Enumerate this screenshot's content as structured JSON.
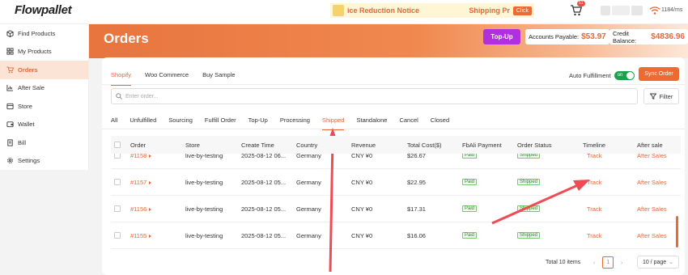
{
  "topbar": {
    "logo": "Flowpallet",
    "notice_left": "ice Reduction Notice",
    "notice_right": "Shipping Pr",
    "notice_button": "Click",
    "cart_badge": "51",
    "ping": "1184/ms"
  },
  "sidebar": {
    "items": [
      {
        "label": "Find Products",
        "icon": "box-icon"
      },
      {
        "label": "My Products",
        "icon": "grid-icon"
      },
      {
        "label": "Orders",
        "icon": "cart-icon",
        "active": true
      },
      {
        "label": "After Sale",
        "icon": "chart-icon"
      },
      {
        "label": "Store",
        "icon": "store-icon"
      },
      {
        "label": "Wallet",
        "icon": "wallet-icon"
      },
      {
        "label": "Bill",
        "icon": "bill-icon"
      },
      {
        "label": "Settings",
        "icon": "gear-icon"
      }
    ]
  },
  "header": {
    "title": "Orders",
    "topup": "Top-Up",
    "accounts_payable_label": "Accounts Payable:",
    "accounts_payable_value": "$53.97",
    "credit_balance_label": "Credit Balance:",
    "credit_balance_value": "$4836.96"
  },
  "platform_tabs": [
    "Shopify",
    "Woo Commerce",
    "Buy Sample"
  ],
  "auto_fulfillment": {
    "label": "Auto Fulfillment",
    "toggle": "on"
  },
  "sync_order": "Sync Order",
  "search": {
    "placeholder": "Enter order..."
  },
  "filter": "Filter",
  "status_tabs": [
    "All",
    "Unfulfilled",
    "Sourcing",
    "Fulfill Order",
    "Top-Up",
    "Processing",
    "Shipped",
    "Standalone",
    "Cancel",
    "Closed"
  ],
  "table": {
    "columns": [
      "Order",
      "Store",
      "Create Time",
      "Country",
      "Revenue",
      "Total Cost($)",
      "FbAli Payment",
      "Order Status",
      "Timeline",
      "After sale"
    ],
    "rows": [
      {
        "order": "#1158",
        "store": "live-by-testing",
        "time": "2025-08-12 06...",
        "country": "Germany",
        "revenue": "CNY ¥0",
        "cost": "$26.67",
        "payment": "Paid",
        "status": "Shipped",
        "timeline": "Track",
        "after": "After Sales"
      },
      {
        "order": "#1157",
        "store": "live-by-testing",
        "time": "2025-08-12 05...",
        "country": "Germany",
        "revenue": "CNY ¥0",
        "cost": "$22.95",
        "payment": "Paid",
        "status": "Shipped",
        "timeline": "Track",
        "after": "After Sales"
      },
      {
        "order": "#1156",
        "store": "live-by-testing",
        "time": "2025-08-12 05...",
        "country": "Germany",
        "revenue": "CNY ¥0",
        "cost": "$17.31",
        "payment": "Paid",
        "status": "Shipped",
        "timeline": "Track",
        "after": "After Sales"
      },
      {
        "order": "#1155",
        "store": "live-by-testing",
        "time": "2025-08-12 05...",
        "country": "Germany",
        "revenue": "CNY ¥0",
        "cost": "$16.06",
        "payment": "Paid",
        "status": "Shipped",
        "timeline": "Track",
        "after": "After Sales"
      }
    ]
  },
  "pagination": {
    "total": "Total 10 items",
    "page": "1",
    "per_page": "10 / page"
  },
  "colors": {
    "accent": "#ee6a32",
    "topup": "#b12fdc",
    "annotation": "#ef4b55"
  }
}
